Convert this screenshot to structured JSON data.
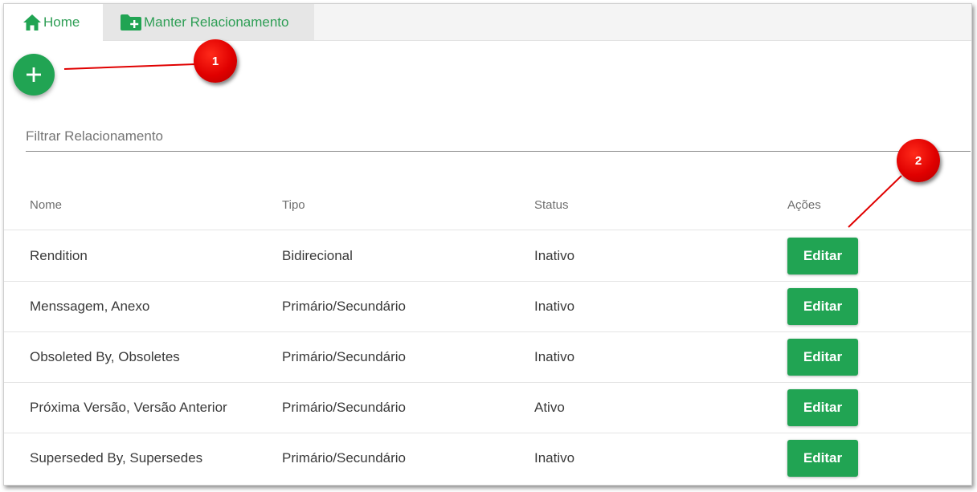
{
  "tabs": [
    {
      "label": "Home",
      "icon": "home-icon"
    },
    {
      "label": "Manter Relacionamento",
      "icon": "folder-plus-icon"
    }
  ],
  "add_button": {
    "icon": "plus-icon"
  },
  "filter": {
    "placeholder": "Filtrar Relacionamento",
    "value": ""
  },
  "table": {
    "headers": {
      "nome": "Nome",
      "tipo": "Tipo",
      "status": "Status",
      "acoes": "Ações"
    },
    "rows": [
      {
        "nome": "Rendition",
        "tipo": "Bidirecional",
        "status": "Inativo",
        "action": "Editar"
      },
      {
        "nome": "Menssagem, Anexo",
        "tipo": "Primário/Secundário",
        "status": "Inativo",
        "action": "Editar"
      },
      {
        "nome": "Obsoleted By, Obsoletes",
        "tipo": "Primário/Secundário",
        "status": "Inativo",
        "action": "Editar"
      },
      {
        "nome": "Próxima Versão, Versão Anterior",
        "tipo": "Primário/Secundário",
        "status": "Ativo",
        "action": "Editar"
      },
      {
        "nome": "Superseded By, Supersedes",
        "tipo": "Primário/Secundário",
        "status": "Inativo",
        "action": "Editar"
      }
    ]
  },
  "annotations": [
    {
      "label": "1"
    },
    {
      "label": "2"
    }
  ],
  "colors": {
    "accent": "#21a453",
    "tab_text": "#2e9e55",
    "annotation": "#e00000"
  }
}
